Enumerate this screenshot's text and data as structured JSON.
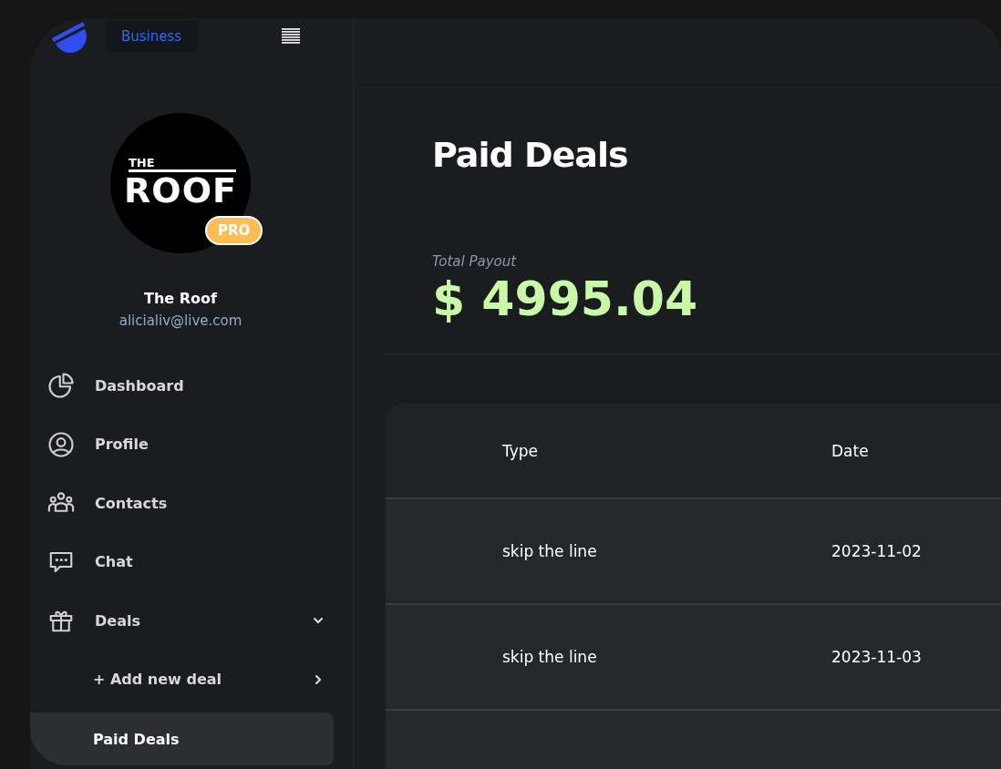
{
  "brand": {
    "badge": "Business"
  },
  "profile": {
    "logo_top": "THE",
    "logo_main": "ROOF",
    "tier": "PRO",
    "name": "The Roof",
    "email": "alicialiv@live.com"
  },
  "nav": [
    {
      "label": "Dashboard",
      "selected": false
    },
    {
      "label": "Profile",
      "selected": false
    },
    {
      "label": "Contacts",
      "selected": false
    },
    {
      "label": "Chat",
      "selected": false
    },
    {
      "label": "Deals",
      "selected": false,
      "expanded": true,
      "children": [
        {
          "label": "+ Add new deal",
          "selected": false
        },
        {
          "label": "Paid Deals",
          "selected": true
        }
      ]
    }
  ],
  "page": {
    "title": "Paid Deals",
    "payout_label": "Total Payout",
    "payout": "$ 4995.04"
  },
  "table": {
    "columns": [
      "Type",
      "Date"
    ],
    "rows": [
      [
        "skip the line",
        "2023-11-02"
      ],
      [
        "skip the line",
        "2023-11-03"
      ],
      []
    ]
  }
}
